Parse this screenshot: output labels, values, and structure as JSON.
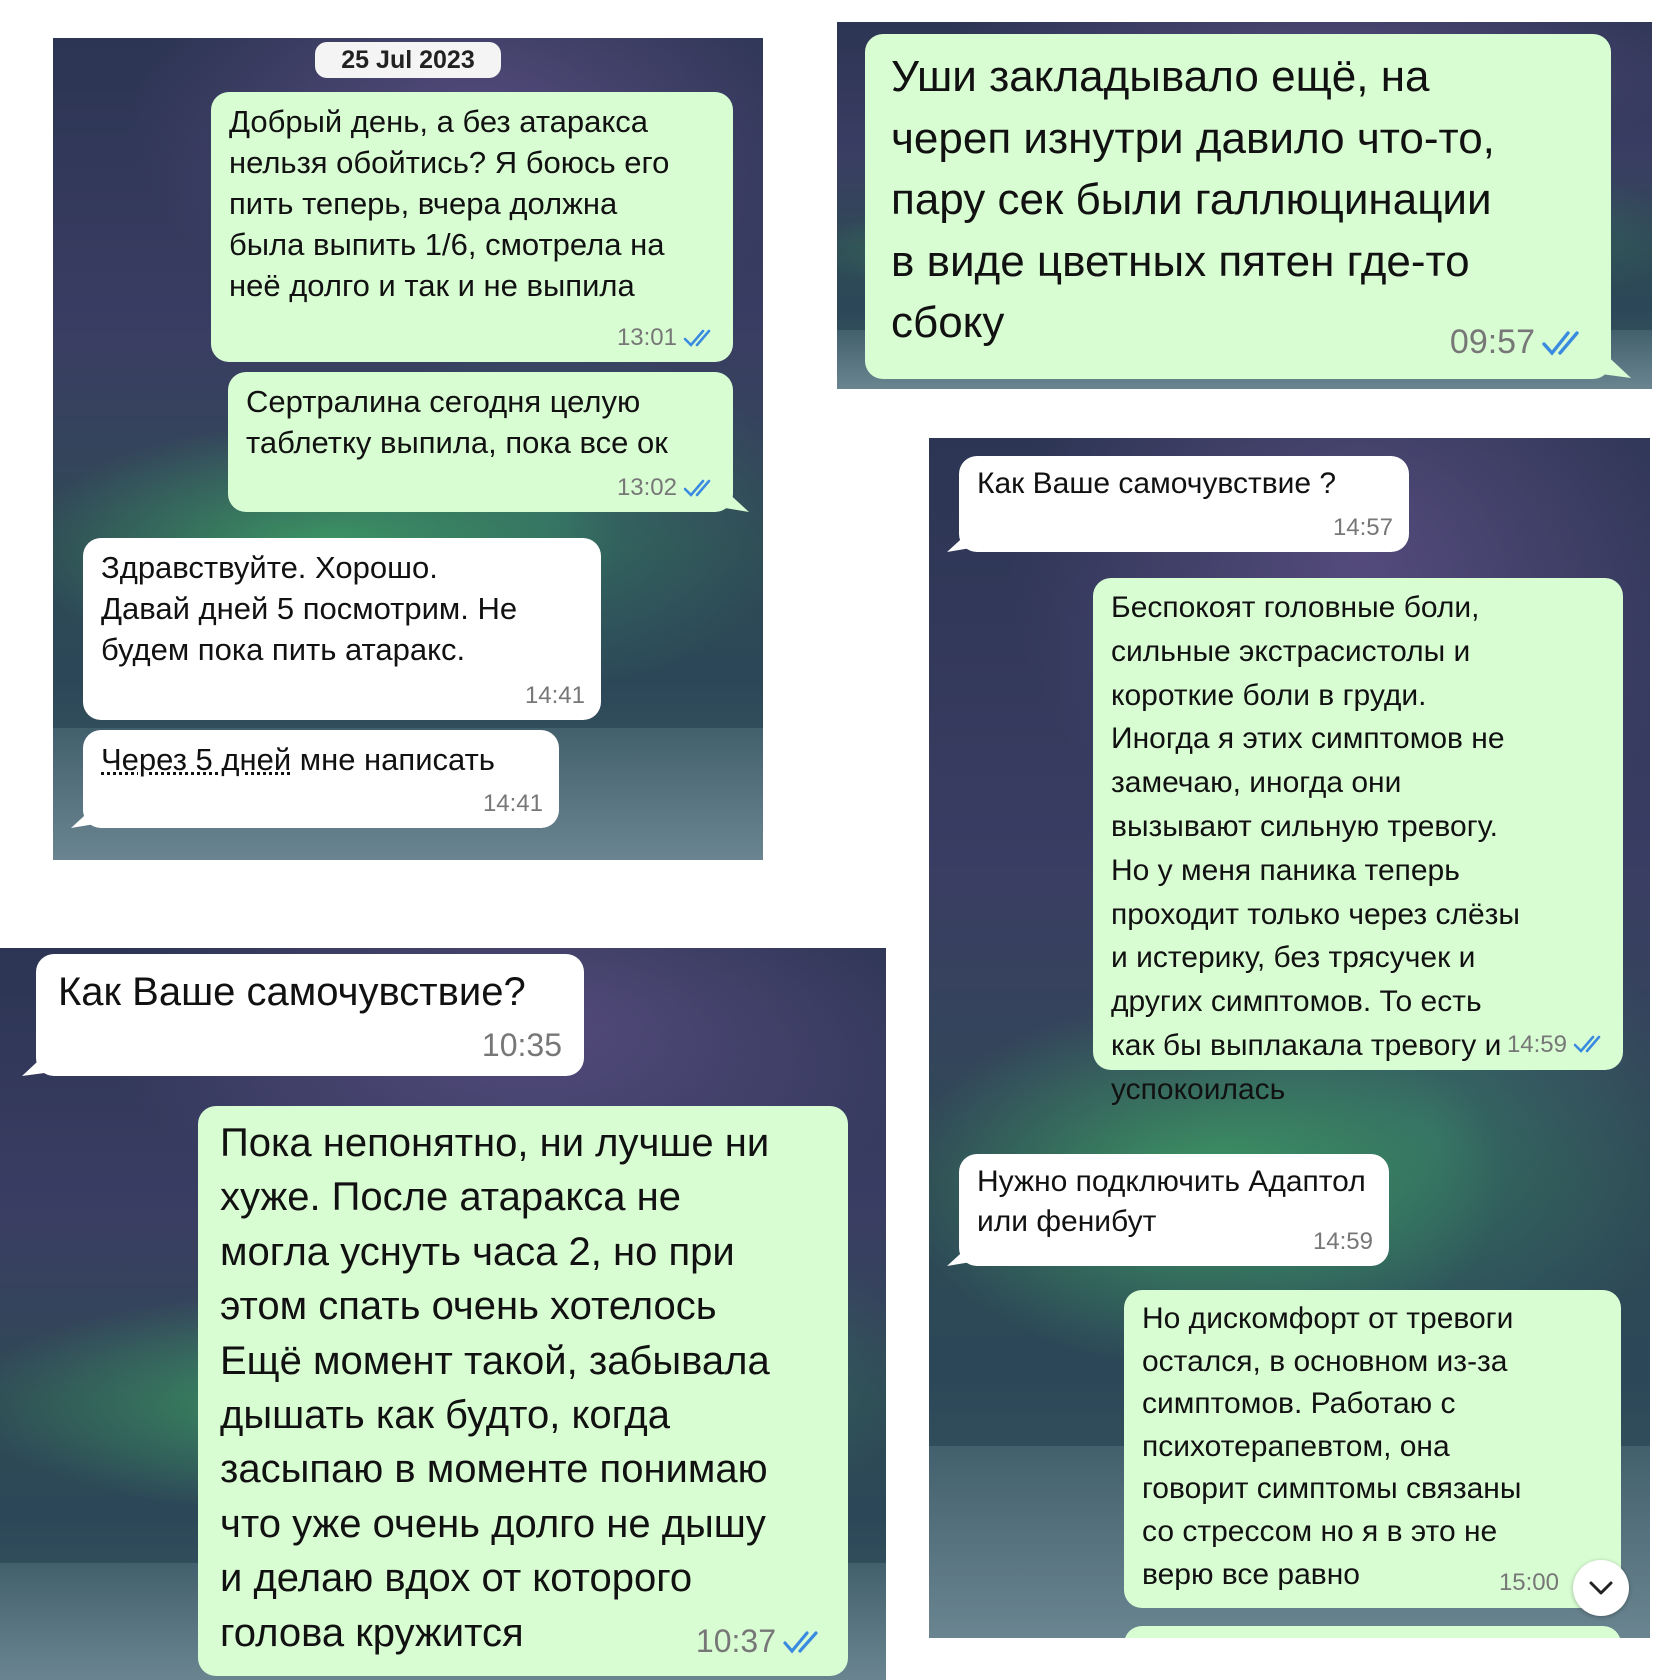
{
  "panel1": {
    "date_chip": "25 Jul 2023",
    "messages": [
      {
        "text": "Добрый день, а без атаракса\nнельзя обойтись? Я боюсь его\nпить теперь, вчера должна\nбыла выпить 1/6, смотрела на\nнеё долго и так и не выпила",
        "time": "13:01",
        "direction": "outgoing"
      },
      {
        "text": "Сертралина сегодня целую\nтаблетку выпила, пока все ок",
        "time": "13:02",
        "direction": "outgoing"
      },
      {
        "text": "Здравствуйте.  Хорошо.\nДавай дней 5 посмотрим.  Не\nбудем пока пить атаракс.",
        "time": "14:41",
        "direction": "incoming"
      },
      {
        "text_link": "Через 5 дней",
        "text_rest": " мне написать",
        "time": "14:41",
        "direction": "incoming"
      }
    ]
  },
  "panel2": {
    "messages": [
      {
        "text": "Уши закладывало ещё, на\nчереп изнутри давило что-то,\nпару сек были галлюцинации\nв виде цветных пятен где-то\nсбоку",
        "time": "09:57",
        "direction": "outgoing"
      }
    ]
  },
  "panel3": {
    "messages": [
      {
        "text": "Как Ваше самочувствие?",
        "time": "10:35",
        "direction": "incoming"
      },
      {
        "text": "Пока непонятно, ни лучше ни\nхуже. После атаракса не\nмогла уснуть часа 2, но при\nэтом спать очень хотелось\nЕщё момент такой, забывала\nдышать как будто, когда\nзасыпаю в моменте понимаю\nчто уже очень долго не дышу\nи делаю вдох от которого\nголова кружится",
        "time": "10:37",
        "direction": "outgoing"
      }
    ]
  },
  "panel4": {
    "messages": [
      {
        "text": "Как Ваше самочувствие ?",
        "time": "14:57",
        "direction": "incoming"
      },
      {
        "text": "Беспокоят головные боли,\nсильные экстрасистолы и\nкороткие боли в груди.\nИногда я этих симптомов не\nзамечаю, иногда они\nвызывают сильную тревогу.\nНо у меня паника теперь\nпроходит только через слёзы\nи истерику, без трясучек и\nдругих симптомов. То есть\nкак бы выплакала тревогу и\nуспокоилась",
        "time": "14:59",
        "direction": "outgoing"
      },
      {
        "text": "Нужно подключить Адаптол\nили фенибут",
        "time": "14:59",
        "direction": "incoming"
      },
      {
        "text": "Но дискомфорт от тревоги\nостался, в основном из-за\nсимптомов. Работаю с\nпсихотерапевтом, она\nговорит симптомы связаны\nсо стрессом но я в это не\nверю все равно",
        "time": "15:00",
        "direction": "outgoing"
      }
    ],
    "scroll_down_icon": "chevron-down-icon"
  },
  "colors": {
    "outgoing_bubble": "#d9fdd3",
    "incoming_bubble": "#ffffff",
    "read_ticks": "#3a8be0"
  }
}
